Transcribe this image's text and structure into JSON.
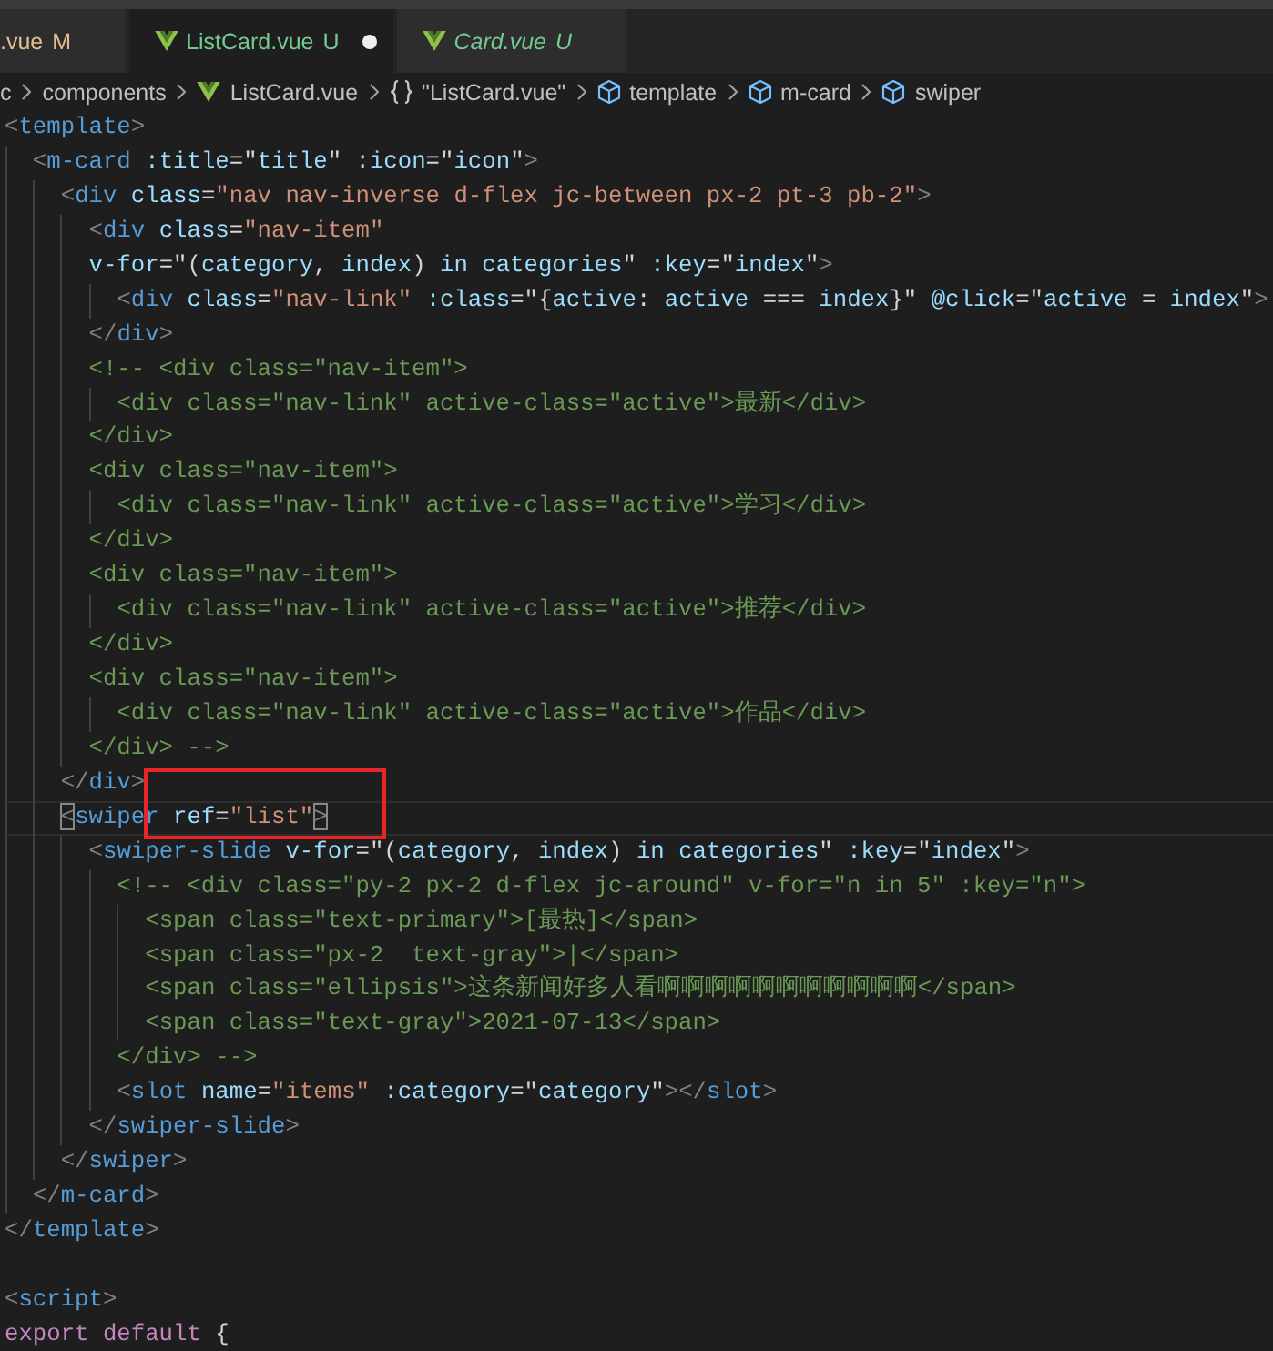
{
  "tabs": [
    {
      "label": ".vue",
      "status": "M",
      "color": "#e2c08d",
      "icon": false,
      "selected": false,
      "unsaved": false,
      "preview": false
    },
    {
      "label": "ListCard.vue",
      "status": "U",
      "color": "#73c991",
      "icon": true,
      "selected": true,
      "unsaved": true,
      "preview": false
    },
    {
      "label": "Card.vue",
      "status": "U",
      "color": "#73c991",
      "icon": true,
      "selected": false,
      "unsaved": false,
      "preview": true
    }
  ],
  "breadcrumbs": [
    {
      "kind": "folder",
      "label": "c"
    },
    {
      "kind": "folder",
      "label": "components"
    },
    {
      "kind": "file",
      "label": "ListCard.vue"
    },
    {
      "kind": "module",
      "label": "\"ListCard.vue\""
    },
    {
      "kind": "element",
      "label": "template"
    },
    {
      "kind": "element",
      "label": "m-card"
    },
    {
      "kind": "element",
      "label": "swiper"
    }
  ],
  "editor": {
    "lines": [
      {
        "kind": "markup",
        "text": "<template>",
        "current": false
      },
      {
        "kind": "markup",
        "text": "  <m-card :title=\"title\" :icon=\"icon\">",
        "current": false
      },
      {
        "kind": "markup",
        "text": "    <div class=\"nav nav-inverse d-flex jc-between px-2 pt-3 pb-2\">",
        "current": false
      },
      {
        "kind": "markup",
        "text": "      <div class=\"nav-item\"",
        "current": false
      },
      {
        "kind": "markup",
        "text": "      v-for=\"(category, index) in categories\" :key=\"index\">",
        "current": false
      },
      {
        "kind": "markup",
        "text": "        <div class=\"nav-link\" :class=\"{active: active === index}\" @click=\"active = index\">",
        "current": false
      },
      {
        "kind": "markup",
        "text": "      </div>",
        "current": false
      },
      {
        "kind": "comment",
        "text": "      <!-- <div class=\"nav-item\">",
        "current": false
      },
      {
        "kind": "comment",
        "text": "        <div class=\"nav-link\" active-class=\"active\">最新</div>",
        "current": false
      },
      {
        "kind": "comment",
        "text": "      </div>",
        "current": false
      },
      {
        "kind": "comment",
        "text": "      <div class=\"nav-item\">",
        "current": false
      },
      {
        "kind": "comment",
        "text": "        <div class=\"nav-link\" active-class=\"active\">学习</div>",
        "current": false
      },
      {
        "kind": "comment",
        "text": "      </div>",
        "current": false
      },
      {
        "kind": "comment",
        "text": "      <div class=\"nav-item\">",
        "current": false
      },
      {
        "kind": "comment",
        "text": "        <div class=\"nav-link\" active-class=\"active\">推荐</div>",
        "current": false
      },
      {
        "kind": "comment",
        "text": "      </div>",
        "current": false
      },
      {
        "kind": "comment",
        "text": "      <div class=\"nav-item\">",
        "current": false
      },
      {
        "kind": "comment",
        "text": "        <div class=\"nav-link\" active-class=\"active\">作品</div>",
        "current": false
      },
      {
        "kind": "comment",
        "text": "      </div> -->",
        "current": false
      },
      {
        "kind": "markup",
        "text": "    </div>",
        "current": false
      },
      {
        "kind": "markup",
        "text": "    <swiper ref=\"list\">",
        "current": true
      },
      {
        "kind": "markup",
        "text": "      <swiper-slide v-for=\"(category, index) in categories\" :key=\"index\">",
        "current": false
      },
      {
        "kind": "comment",
        "text": "        <!-- <div class=\"py-2 px-2 d-flex jc-around\" v-for=\"n in 5\" :key=\"n\">",
        "current": false
      },
      {
        "kind": "comment",
        "text": "          <span class=\"text-primary\">[最热]</span>",
        "current": false
      },
      {
        "kind": "comment",
        "text": "          <span class=\"px-2  text-gray\">|</span>",
        "current": false
      },
      {
        "kind": "comment",
        "text": "          <span class=\"ellipsis\">这条新闻好多人看啊啊啊啊啊啊啊啊啊啊啊</span>",
        "current": false
      },
      {
        "kind": "comment",
        "text": "          <span class=\"text-gray\">2021-07-13</span>",
        "current": false
      },
      {
        "kind": "comment",
        "text": "        </div> -->",
        "current": false
      },
      {
        "kind": "markup",
        "text": "        <slot name=\"items\" :category=\"category\"></slot>",
        "current": false
      },
      {
        "kind": "markup",
        "text": "      </swiper-slide>",
        "current": false
      },
      {
        "kind": "markup",
        "text": "    </swiper>",
        "current": false
      },
      {
        "kind": "markup",
        "text": "  </m-card>",
        "current": false
      },
      {
        "kind": "markup",
        "text": "</template>",
        "current": false
      },
      {
        "kind": "blank",
        "current": false
      },
      {
        "kind": "markup",
        "text": "<script>",
        "current": false
      },
      {
        "kind": "script",
        "text": "export default {",
        "current": false
      }
    ]
  }
}
